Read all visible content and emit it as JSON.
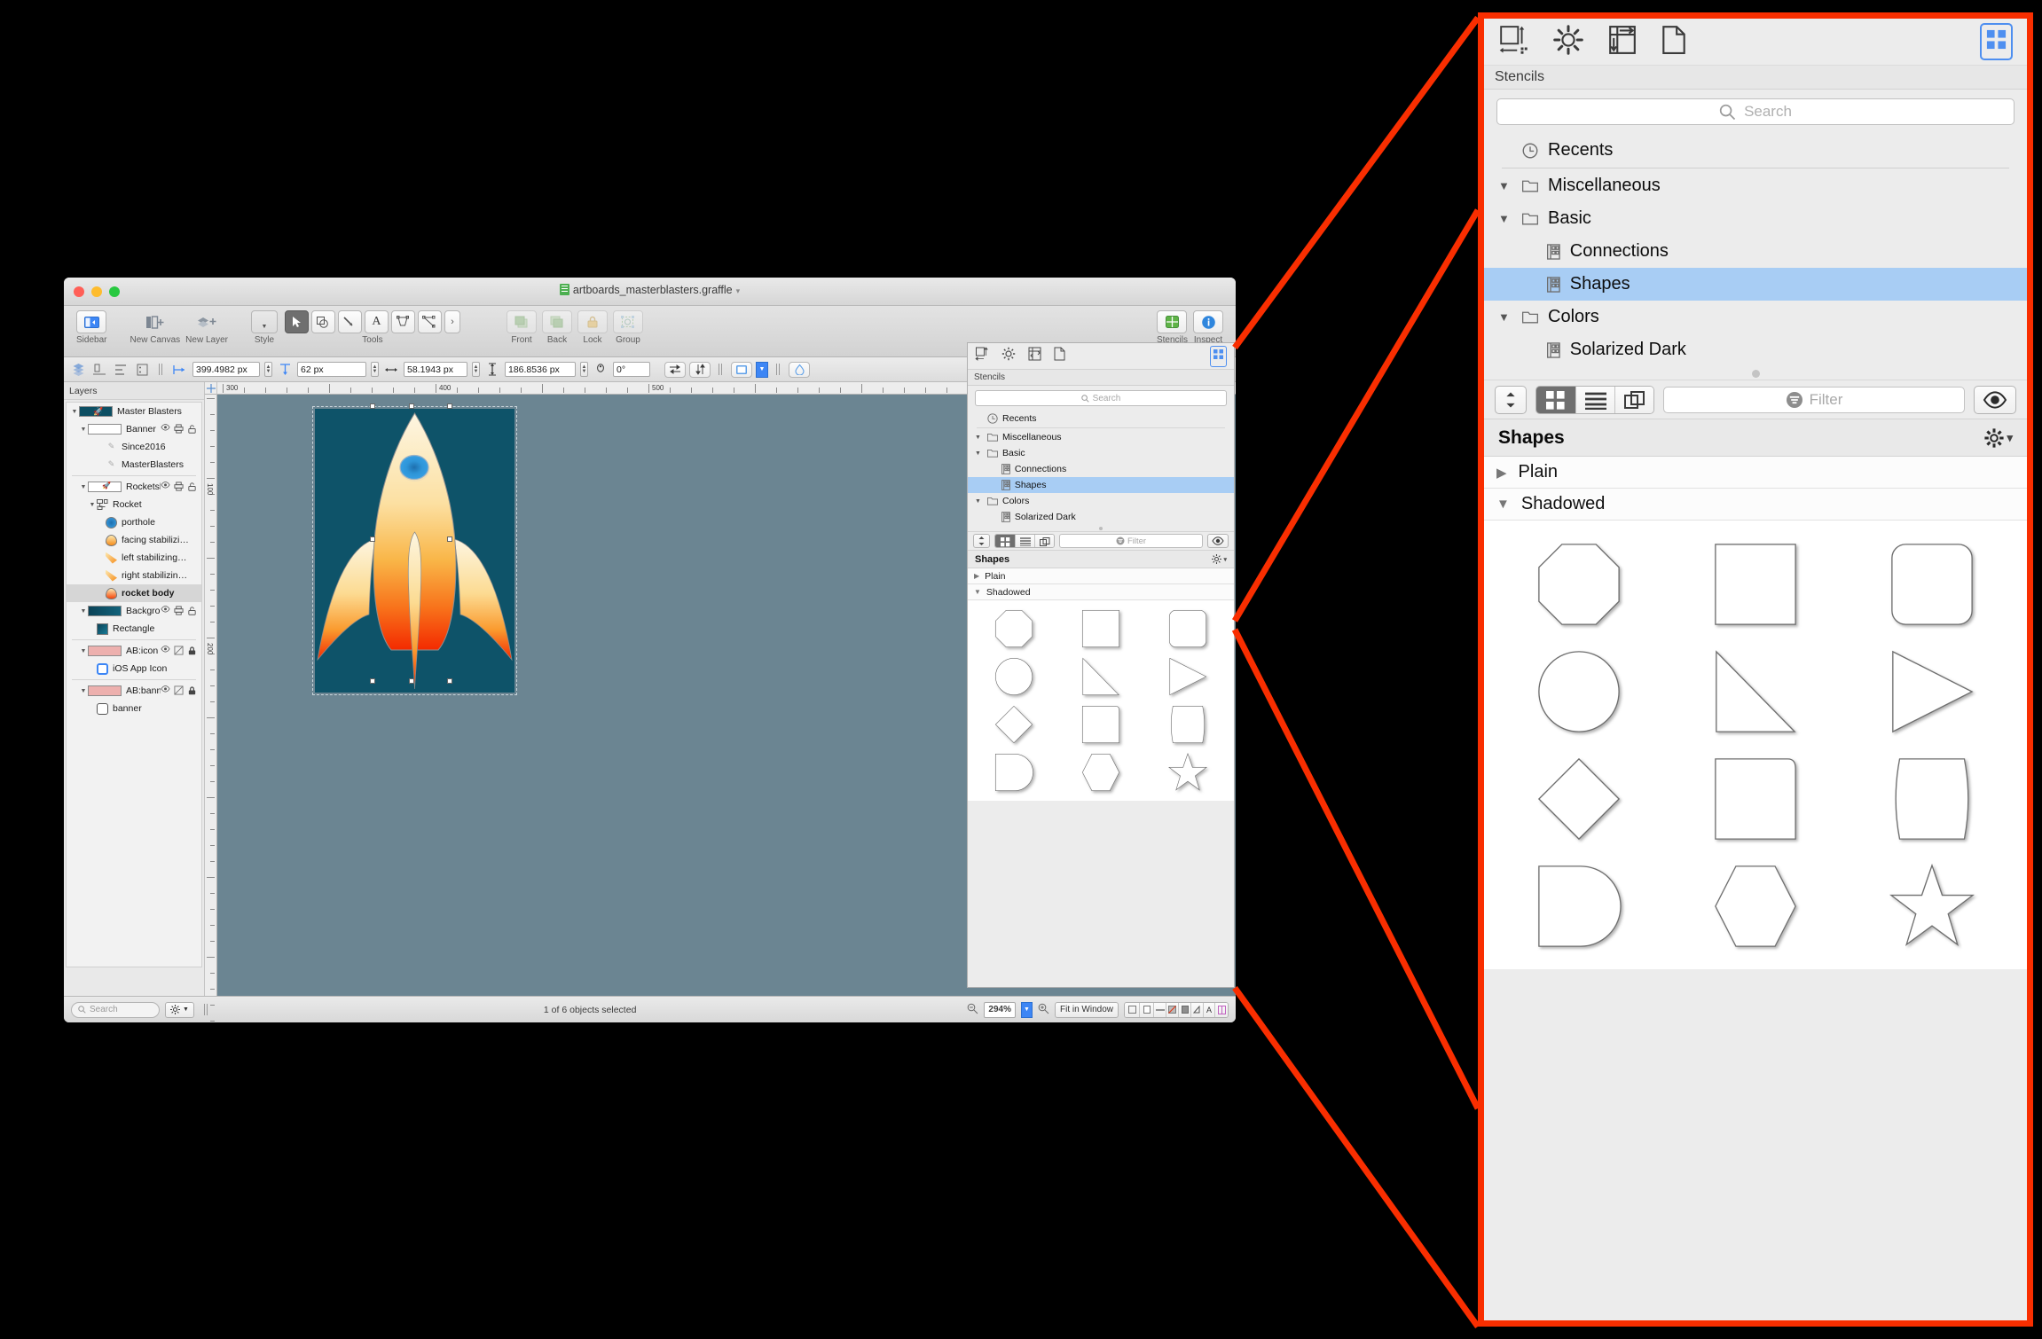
{
  "window": {
    "title": "artboards_masterblasters.graffle",
    "traffic_lights": [
      "close",
      "minimize",
      "zoom"
    ]
  },
  "toolbar": {
    "groups": [
      {
        "label": "Sidebar",
        "icons": [
          "sidebar-icon"
        ]
      },
      {
        "label": "New Canvas",
        "icons": [
          "new-canvas-icon"
        ]
      },
      {
        "label": "New Layer",
        "icons": [
          "new-layer-icon"
        ]
      },
      {
        "label": "Style",
        "icons": [
          "style-dropdown-icon"
        ]
      },
      {
        "label": "Tools",
        "icons": [
          "select-tool-icon",
          "shape-tool-icon",
          "line-tool-icon",
          "text-tool-icon",
          "pen-tool-icon",
          "bezier-tool-icon",
          "more-tools-icon"
        ]
      },
      {
        "label": "Front",
        "icons": [
          "bring-front-icon"
        ]
      },
      {
        "label": "Back",
        "icons": [
          "send-back-icon"
        ]
      },
      {
        "label": "Lock",
        "icons": [
          "lock-icon"
        ]
      },
      {
        "label": "Group",
        "icons": [
          "group-icon"
        ]
      },
      {
        "label": "Stencils",
        "icons": [
          "stencils-icon"
        ]
      },
      {
        "label": "Inspect",
        "icons": [
          "inspect-icon"
        ]
      }
    ]
  },
  "geometry_bar": {
    "x_value": "399.4982 px",
    "y_value": "62 px",
    "width_value": "58.1943 px",
    "height_value": "186.8536 px",
    "angle_value": "0°"
  },
  "rulers": {
    "horizontal_ticks": [
      "300",
      "400",
      "500"
    ],
    "vertical_ticks": [
      "100",
      "200"
    ]
  },
  "layers_panel": {
    "header": "Layers",
    "rows": [
      {
        "indent": 0,
        "tri": "▼",
        "kind": "thumb",
        "label": "Master Blasters",
        "icons": []
      },
      {
        "indent": 1,
        "tri": "▼",
        "kind": "thumb",
        "label": "Banner",
        "icons": [
          "eye-icon",
          "print-icon",
          "unlock-icon"
        ]
      },
      {
        "indent": 3,
        "tri": "",
        "kind": "text",
        "label": "Since2016",
        "icons": []
      },
      {
        "indent": 3,
        "tri": "",
        "kind": "text",
        "label": "MasterBlasters",
        "icons": []
      },
      {
        "indent": 1,
        "tri": "▼",
        "kind": "thumb",
        "label": "Rocketship",
        "icons": [
          "eye-icon",
          "print-icon",
          "unlock-icon"
        ]
      },
      {
        "indent": 2,
        "tri": "▼",
        "kind": "grouping",
        "label": "Rocket",
        "icons": []
      },
      {
        "indent": 3,
        "tri": "",
        "kind": "swatch",
        "label": "porthole",
        "icons": []
      },
      {
        "indent": 3,
        "tri": "",
        "kind": "swatch",
        "label": "facing stabilizi…",
        "icons": []
      },
      {
        "indent": 3,
        "tri": "",
        "kind": "swatch",
        "label": "left stabilizing…",
        "icons": []
      },
      {
        "indent": 3,
        "tri": "",
        "kind": "swatch",
        "label": "right stabilizin…",
        "icons": []
      },
      {
        "indent": 3,
        "tri": "",
        "kind": "swatch",
        "label": "rocket body",
        "icons": [],
        "selected": true
      },
      {
        "indent": 1,
        "tri": "▼",
        "kind": "thumb",
        "label": "Backgrou…",
        "icons": [
          "eye-icon",
          "print-icon",
          "unlock-icon"
        ]
      },
      {
        "indent": 2,
        "tri": "",
        "kind": "swatch",
        "label": "Rectangle",
        "icons": []
      },
      {
        "indent": 1,
        "tri": "▼",
        "kind": "thumb",
        "label": "AB:icon",
        "icons": [
          "eye-icon",
          "noprint-icon",
          "lock-icon"
        ]
      },
      {
        "indent": 2,
        "tri": "",
        "kind": "swatch",
        "label": "iOS App Icon",
        "icons": []
      },
      {
        "indent": 1,
        "tri": "▼",
        "kind": "thumb",
        "label": "AB:banner",
        "icons": [
          "eye-icon",
          "noprint-icon",
          "lock-icon"
        ]
      },
      {
        "indent": 2,
        "tri": "",
        "kind": "swatch",
        "label": "banner",
        "icons": []
      }
    ]
  },
  "status_bar": {
    "search_placeholder": "Search",
    "selection_text": "1 of 6 objects selected",
    "zoom_value": "294%",
    "fit_label": "Fit in Window"
  },
  "stencils_panel": {
    "toolbar_icons": [
      "canvas-size-icon",
      "gear-icon",
      "grid-icon",
      "document-icon",
      "stencils-grid-icon"
    ],
    "title": "Stencils",
    "search_placeholder": "Search",
    "tree": [
      {
        "level": 0,
        "tri": "",
        "icon": "clock-icon",
        "label": "Recents"
      },
      {
        "level": 0,
        "tri": "▼",
        "icon": "folder-icon",
        "label": "Miscellaneous"
      },
      {
        "level": 0,
        "tri": "▼",
        "icon": "folder-icon",
        "label": "Basic"
      },
      {
        "level": 1,
        "tri": "",
        "icon": "stencil-icon",
        "label": "Connections"
      },
      {
        "level": 1,
        "tri": "",
        "icon": "stencil-icon",
        "label": "Shapes",
        "selected": true
      },
      {
        "level": 0,
        "tri": "▼",
        "icon": "folder-icon",
        "label": "Colors"
      },
      {
        "level": 1,
        "tri": "",
        "icon": "stencil-icon",
        "label": "Solarized Dark"
      }
    ],
    "filter_bar": {
      "sort_icon": "sort-stepper-icon",
      "view_grid_icon": "grid-view-icon",
      "view_list_icon": "list-view-icon",
      "view_compact_icon": "compact-view-icon",
      "filter_placeholder": "Filter",
      "preview_icon": "eye-icon"
    },
    "library_header": {
      "title": "Shapes",
      "action_icon": "gear-dropdown-icon"
    },
    "groups": [
      {
        "label": "Plain",
        "tri": "▶",
        "expanded": false
      },
      {
        "label": "Shadowed",
        "tri": "▼",
        "expanded": true
      }
    ],
    "shapes": [
      "octagon",
      "square",
      "rounded-square",
      "circle",
      "right-triangle",
      "play-triangle",
      "diamond",
      "square-2",
      "barrel",
      "d-shape",
      "hexagon",
      "star"
    ],
    "selection_color": "#a8cdf4"
  },
  "callout": {
    "border_color": "#f92e00"
  },
  "canvas": {
    "artboard_bg": "#0e5369",
    "canvas_bg": "#6b8592",
    "rocket": {
      "body_gradient_top": "#fdf4dc",
      "body_gradient_mid": "#f9c25a",
      "body_gradient_bottom": "#f42b00",
      "porthole_color": "#2e95d8"
    }
  }
}
